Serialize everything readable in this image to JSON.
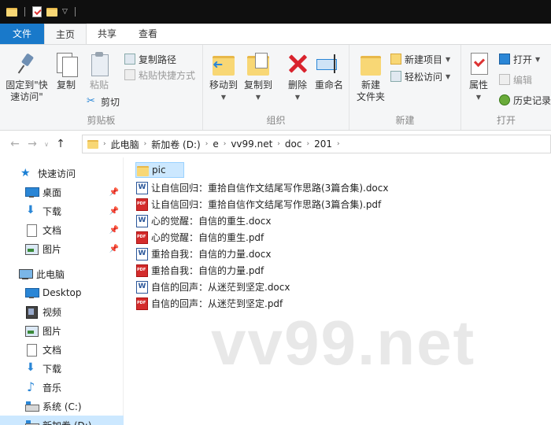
{
  "ribbon_tabs": [
    "文件",
    "主页",
    "共享",
    "查看"
  ],
  "ribbon": {
    "clipboard": {
      "pin_label": "固定到\"快\n速访问\"",
      "copy_label": "复制",
      "paste_label": "粘贴",
      "copy_path": "复制路径",
      "paste_shortcut": "粘贴快捷方式",
      "cut": "剪切",
      "group": "剪贴板"
    },
    "organize": {
      "move_to": "移动到",
      "copy_to": "复制到",
      "delete": "删除",
      "rename": "重命名",
      "group": "组织"
    },
    "new": {
      "new_folder": "新建\n文件夹",
      "new_item": "新建项目",
      "easy_access": "轻松访问",
      "group": "新建"
    },
    "open": {
      "properties": "属性",
      "open": "打开",
      "edit": "编辑",
      "history": "历史记录",
      "group": "打开"
    }
  },
  "address": {
    "crumbs": [
      "此电脑",
      "新加卷 (D:)",
      "e",
      "vv99.net",
      "doc",
      "201"
    ]
  },
  "nav": {
    "quick_access": "快速访问",
    "quick_items": [
      "桌面",
      "下载",
      "文档",
      "图片"
    ],
    "this_pc": "此电脑",
    "pc_items": [
      "Desktop",
      "视频",
      "图片",
      "文档",
      "下载",
      "音乐",
      "系统 (C:)",
      "新加卷 (D:)"
    ]
  },
  "files": [
    {
      "name": "pic",
      "type": "folder"
    },
    {
      "name": "让自信回归：重拾自信作文结尾写作思路(3篇合集).docx",
      "type": "docx"
    },
    {
      "name": "让自信回归：重拾自信作文结尾写作思路(3篇合集).pdf",
      "type": "pdf"
    },
    {
      "name": "心的觉醒：自信的重生.docx",
      "type": "docx"
    },
    {
      "name": "心的觉醒：自信的重生.pdf",
      "type": "pdf"
    },
    {
      "name": "重拾自我：自信的力量.docx",
      "type": "docx"
    },
    {
      "name": "重拾自我：自信的力量.pdf",
      "type": "pdf"
    },
    {
      "name": "自信的回声：从迷茫到坚定.docx",
      "type": "docx"
    },
    {
      "name": "自信的回声：从迷茫到坚定.pdf",
      "type": "pdf"
    }
  ],
  "watermark": "vv99.net"
}
